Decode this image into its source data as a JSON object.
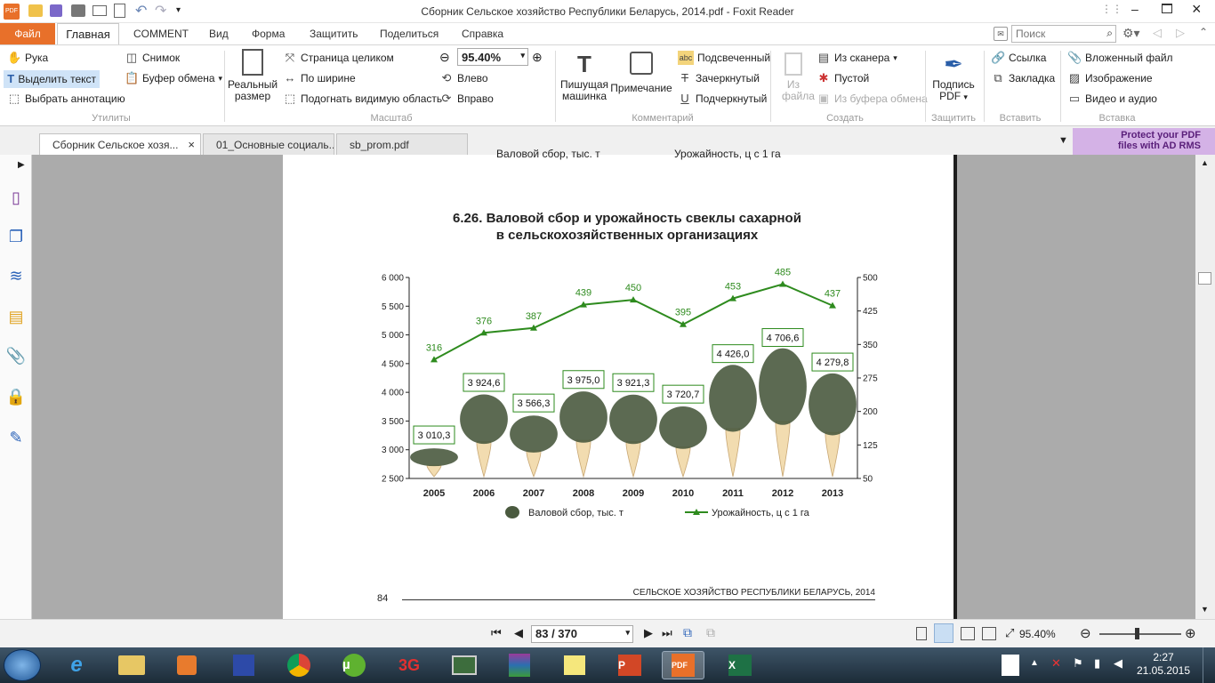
{
  "window": {
    "title": "Сборник Сельское хозяйство Республики Беларусь, 2014.pdf - Foxit Reader"
  },
  "menu": {
    "file": "Файл",
    "home": "Главная",
    "comment": "COMMENT",
    "view": "Вид",
    "form": "Форма",
    "protect": "Защитить",
    "share": "Поделиться",
    "help": "Справка",
    "search_placeholder": "Поиск"
  },
  "ribbon": {
    "hand": "Рука",
    "select_text": "Выделить текст",
    "select_annotation": "Выбрать аннотацию",
    "snapshot": "Снимок",
    "clipboard": "Буфер обмена",
    "group_tools": "Утилиты",
    "actual_size": "Реальный размер",
    "fit_page": "Страница целиком",
    "fit_width": "По ширине",
    "fit_visible": "Подогнать видимую область",
    "zoom": "95.40%",
    "rotate_left": "Влево",
    "rotate_right": "Вправо",
    "group_zoom": "Масштаб",
    "typewriter": "Пишущая машинка",
    "note": "Примечание",
    "highlight": "Подсвеченный",
    "strikeout": "Зачеркнутый",
    "underline": "Подчеркнутый",
    "group_comments": "Комментарий",
    "from_file": "Из файла",
    "from_scanner": "Из сканера",
    "blank": "Пустой",
    "from_clipboard": "Из буфера обмена",
    "group_create": "Создать",
    "sign_pdf": "Подпись PDF",
    "group_protect": "Защитить",
    "link": "Ссылка",
    "bookmark": "Закладка",
    "group_insert": "Вставить",
    "attached_file": "Вложенный файл",
    "image": "Изображение",
    "video_audio": "Видео и аудио",
    "group_insert2": "Вставка"
  },
  "tabs": [
    {
      "label": "Сборник Сельское хозя..."
    },
    {
      "label": "01_Основные социаль..."
    },
    {
      "label": "sb_prom.pdf"
    }
  ],
  "ad": {
    "line1": "Protect your PDF",
    "line2": "files with AD RMS"
  },
  "doc": {
    "top_cut": "Валовой сбор, тыс. т                         Урожайность, ц с 1 га",
    "title1": "6.26. Валовой сбор и урожайность свеклы сахарной",
    "title2": "в сельскохозяйственных организациях",
    "page_number": "84",
    "footer": "СЕЛЬСКОЕ ХОЗЯЙСТВО РЕСПУБЛИКИ БЕЛАРУСЬ, 2014"
  },
  "chart_data": {
    "type": "bar",
    "categories": [
      "2005",
      "2006",
      "2007",
      "2008",
      "2009",
      "2010",
      "2011",
      "2012",
      "2013"
    ],
    "series": [
      {
        "name": "Валовой сбор, тыс. т",
        "values": [
          3010.3,
          3924.6,
          3566.3,
          3975.0,
          3921.3,
          3720.7,
          4426.0,
          4706.6,
          4279.8
        ],
        "labels": [
          "3 010,3",
          "3 924,6",
          "3 566,3",
          "3 975,0",
          "3 921,3",
          "3 720,7",
          "4 426,0",
          "4 706,6",
          "4 279,8"
        ],
        "axis": "left"
      },
      {
        "name": "Урожайность, ц с 1 га",
        "values": [
          316,
          376,
          387,
          439,
          450,
          395,
          453,
          485,
          437
        ],
        "axis": "right",
        "type": "line"
      }
    ],
    "ylim": [
      2500,
      6000
    ],
    "y_ticks": [
      "2 500",
      "3 000",
      "3 500",
      "4 000",
      "4 500",
      "5 000",
      "5 500",
      "6 000"
    ],
    "y2lim": [
      50,
      500
    ],
    "y2_ticks": [
      "50",
      "125",
      "200",
      "275",
      "350",
      "425",
      "500"
    ],
    "legend_position": "bottom",
    "colors": {
      "line": "#2e8b1e",
      "label_border": "#2e8b1e",
      "leaf": "#4a5a3f",
      "root": "#f2dcb0"
    }
  },
  "status": {
    "page": "83 / 370",
    "zoom": "95.40%"
  },
  "tray": {
    "time": "2:27",
    "date": "21.05.2015"
  }
}
